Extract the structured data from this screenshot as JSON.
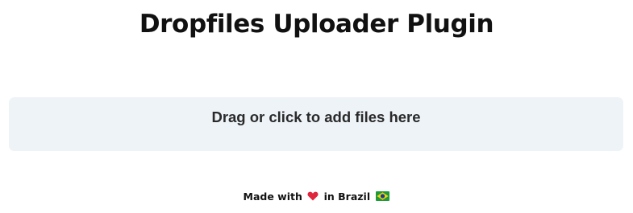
{
  "header": {
    "title": "Dropfiles Uploader Plugin"
  },
  "dropzone": {
    "label": "Drag or click to add files here"
  },
  "footer": {
    "prefix": "Made with",
    "middle": "in Brazil",
    "heart_icon": "heart-icon",
    "flag_icon": "brazil-flag-icon"
  },
  "colors": {
    "dropzone_bg": "#eef3f8",
    "heart": "#e0263c",
    "flag_green": "#1f9a3b",
    "flag_yellow": "#f6d10f",
    "flag_blue": "#1b3b8f"
  }
}
